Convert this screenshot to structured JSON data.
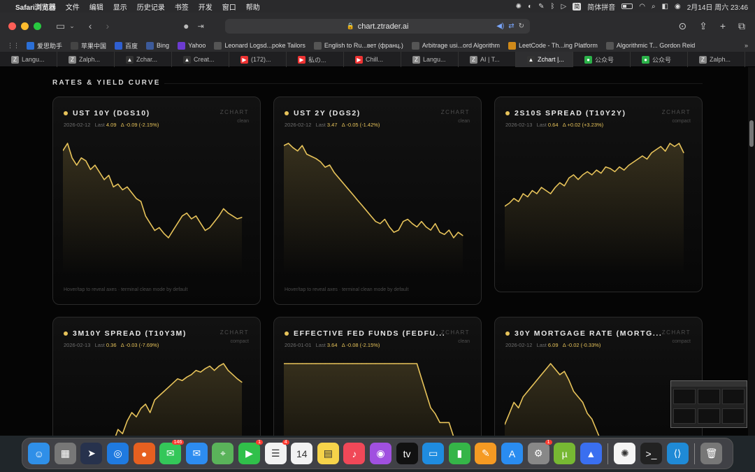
{
  "menubar": {
    "app_name": "Safari浏览器",
    "items": [
      "文件",
      "编辑",
      "显示",
      "历史记录",
      "书签",
      "开发",
      "窗口",
      "帮助"
    ],
    "ime_badge": "简",
    "ime_label": "简体拼音",
    "datetime": "2月14日 周六  23:46"
  },
  "toolbar": {
    "url": "chart.ztrader.ai"
  },
  "bookmarks": [
    {
      "label": "爱思助手",
      "icon": "aisi-icon",
      "color": "#2b6fd6"
    },
    {
      "label": "苹果中国",
      "icon": "apple-icon",
      "color": "#444"
    },
    {
      "label": "百度",
      "icon": "baidu-icon",
      "color": "#2f5fd0"
    },
    {
      "label": "Bing",
      "icon": "bing-icon",
      "color": "#3c5a9a"
    },
    {
      "label": "Yahoo",
      "icon": "yahoo-icon",
      "color": "#6c3bd1"
    },
    {
      "label": "Leonard Logsd...poke Tailors",
      "icon": "tailor-icon",
      "color": "#555"
    },
    {
      "label": "English to Ru...вет (франц.)",
      "icon": "globe-icon",
      "color": "#555"
    },
    {
      "label": "Arbitrage usi...ord Algorithm",
      "icon": "doc-icon",
      "color": "#555"
    },
    {
      "label": "LeetCode - Th...ing Platform",
      "icon": "leetcode-icon",
      "color": "#d08a1a"
    },
    {
      "label": "Algorithmic T... Gordon Reid",
      "icon": "doc-icon",
      "color": "#555"
    }
  ],
  "tabs": [
    {
      "label": "Langu...",
      "icon": "Z",
      "color": "#888"
    },
    {
      "label": "Zalph...",
      "icon": "Z",
      "color": "#888"
    },
    {
      "label": "Zchar...",
      "icon": "▲",
      "color": "#333"
    },
    {
      "label": "Creat...",
      "icon": "▲",
      "color": "#333"
    },
    {
      "label": "(172)...",
      "icon": "▶",
      "color": "#e33"
    },
    {
      "label": "私の...",
      "icon": "▶",
      "color": "#e33"
    },
    {
      "label": "Chill...",
      "icon": "▶",
      "color": "#e33"
    },
    {
      "label": "Langu...",
      "icon": "Z",
      "color": "#888"
    },
    {
      "label": "AI | T...",
      "icon": "Z",
      "color": "#888"
    },
    {
      "label": "Zchart |...",
      "icon": "▲",
      "color": "#333",
      "active": true
    },
    {
      "label": "公众号",
      "icon": "●",
      "color": "#2cb24a"
    },
    {
      "label": "公众号",
      "icon": "●",
      "color": "#2cb24a"
    },
    {
      "label": "Zalph...",
      "icon": "Z",
      "color": "#888"
    }
  ],
  "page": {
    "section_title": "RATES & YIELD CURVE",
    "accent": "#e7c35a",
    "cards": [
      {
        "title": "UST 10Y (DGS10)",
        "brand": "ZCHART",
        "mode": "clean",
        "date": "2026-02-12",
        "last_label": "Last",
        "last": "4.09",
        "delta": "Δ -0.09 (-2.15%)",
        "hint": "Hover/tap to reveal axes · terminal clean mode by default"
      },
      {
        "title": "UST 2Y (DGS2)",
        "brand": "ZCHART",
        "mode": "clean",
        "date": "2026-02-12",
        "last_label": "Last",
        "last": "3.47",
        "delta": "Δ -0.05 (-1.42%)",
        "hint": "Hover/tap to reveal axes · terminal clean mode by default"
      },
      {
        "title": "2S10S SPREAD (T10Y2Y)",
        "brand": "ZCHART",
        "mode": "compact",
        "date": "2026-02-13",
        "last_label": "Last",
        "last": "0.64",
        "delta": "Δ +0.02 (+3.23%)",
        "hint": ""
      },
      {
        "title": "3M10Y SPREAD (T10Y3M)",
        "brand": "ZCHART",
        "mode": "compact",
        "date": "2026-02-13",
        "last_label": "Last",
        "last": "0.36",
        "delta": "Δ -0.03 (-7.69%)",
        "hint": ""
      },
      {
        "title": "EFFECTIVE FED FUNDS (FEDFU...",
        "brand": "ZCHART",
        "mode": "clean",
        "date": "2026-01-01",
        "last_label": "Last",
        "last": "3.64",
        "delta": "Δ -0.08 (-2.15%)",
        "hint": ""
      },
      {
        "title": "30Y MORTGAGE RATE (MORTG...",
        "brand": "ZCHART",
        "mode": "compact",
        "date": "2026-02-12",
        "last_label": "Last",
        "last": "6.09",
        "delta": "Δ -0.02 (-0.33%)",
        "hint": ""
      }
    ]
  },
  "chart_data": [
    {
      "type": "area",
      "series": [
        {
          "values": [
            4.55,
            4.6,
            4.5,
            4.45,
            4.5,
            4.48,
            4.42,
            4.45,
            4.4,
            4.35,
            4.38,
            4.3,
            4.32,
            4.28,
            4.3,
            4.26,
            4.22,
            4.2,
            4.1,
            4.05,
            4.0,
            4.02,
            3.98,
            3.95,
            4.0,
            4.05,
            4.1,
            4.12,
            4.08,
            4.1,
            4.05,
            4.0,
            4.02,
            4.06,
            4.1,
            4.15,
            4.12,
            4.1,
            4.08,
            4.09
          ]
        }
      ]
    },
    {
      "type": "area",
      "series": [
        {
          "values": [
            4.3,
            4.32,
            4.28,
            4.25,
            4.3,
            4.22,
            4.2,
            4.18,
            4.15,
            4.1,
            4.12,
            4.05,
            4.0,
            3.95,
            3.9,
            3.85,
            3.8,
            3.75,
            3.7,
            3.65,
            3.6,
            3.58,
            3.62,
            3.55,
            3.5,
            3.52,
            3.6,
            3.62,
            3.58,
            3.55,
            3.6,
            3.55,
            3.52,
            3.58,
            3.5,
            3.48,
            3.52,
            3.45,
            3.5,
            3.47
          ]
        }
      ]
    },
    {
      "type": "area",
      "series": [
        {
          "values": [
            0.3,
            0.32,
            0.35,
            0.33,
            0.38,
            0.36,
            0.4,
            0.38,
            0.42,
            0.4,
            0.38,
            0.42,
            0.45,
            0.43,
            0.48,
            0.5,
            0.47,
            0.5,
            0.52,
            0.5,
            0.53,
            0.51,
            0.55,
            0.54,
            0.52,
            0.55,
            0.53,
            0.56,
            0.58,
            0.6,
            0.62,
            0.6,
            0.64,
            0.66,
            0.68,
            0.65,
            0.7,
            0.68,
            0.7,
            0.64
          ]
        }
      ]
    },
    {
      "type": "area",
      "series": [
        {
          "values": [
            -0.6,
            -0.55,
            -0.58,
            -0.5,
            -0.52,
            -0.48,
            -0.5,
            -0.45,
            -0.4,
            -0.42,
            -0.3,
            -0.35,
            -0.2,
            -0.25,
            -0.1,
            0.0,
            -0.05,
            0.05,
            0.1,
            0.0,
            0.15,
            0.2,
            0.25,
            0.3,
            0.35,
            0.4,
            0.38,
            0.42,
            0.45,
            0.5,
            0.48,
            0.52,
            0.55,
            0.5,
            0.55,
            0.58,
            0.5,
            0.45,
            0.4,
            0.36
          ]
        }
      ]
    },
    {
      "type": "area",
      "series": [
        {
          "values": [
            5.33,
            5.33,
            5.33,
            5.33,
            5.33,
            5.33,
            5.33,
            5.33,
            5.33,
            5.33,
            5.33,
            5.33,
            5.33,
            5.33,
            5.33,
            5.33,
            5.33,
            5.33,
            5.33,
            5.33,
            5.33,
            5.33,
            5.33,
            5.33,
            5.33,
            5.33,
            5.33,
            5.33,
            5.33,
            5.33,
            5.08,
            4.83,
            4.58,
            4.48,
            4.33,
            4.33,
            4.33,
            4.09,
            3.89,
            3.64
          ]
        }
      ]
    },
    {
      "type": "area",
      "series": [
        {
          "values": [
            6.4,
            6.5,
            6.6,
            6.55,
            6.65,
            6.7,
            6.75,
            6.8,
            6.85,
            6.9,
            6.95,
            6.9,
            6.85,
            6.88,
            6.8,
            6.7,
            6.65,
            6.6,
            6.5,
            6.45,
            6.35,
            6.25,
            6.2,
            6.15,
            6.1,
            6.05,
            6.1,
            6.15,
            6.12,
            6.08,
            6.1,
            6.05,
            6.12,
            6.1,
            6.08,
            6.11,
            6.1,
            6.12,
            6.1,
            6.09
          ]
        }
      ]
    }
  ],
  "dock": [
    {
      "name": "finder",
      "color": "#2f8fe8",
      "glyph": "☺"
    },
    {
      "name": "launchpad",
      "color": "#777",
      "glyph": "▦"
    },
    {
      "name": "telegram",
      "color": "#27324d",
      "glyph": "➤"
    },
    {
      "name": "safari",
      "color": "#1f7ae0",
      "glyph": "◎"
    },
    {
      "name": "firefox",
      "color": "#e66020",
      "glyph": "●"
    },
    {
      "name": "messages",
      "color": "#34c759",
      "glyph": "✉",
      "badge": "146"
    },
    {
      "name": "mail",
      "color": "#2d8cf0",
      "glyph": "✉"
    },
    {
      "name": "maps",
      "color": "#5ab35a",
      "glyph": "⌖"
    },
    {
      "name": "facetime",
      "color": "#30c04a",
      "glyph": "▶",
      "badge": "1"
    },
    {
      "name": "reminders",
      "color": "#f2f2f2",
      "glyph": "☰",
      "badge": "4"
    },
    {
      "name": "calendar",
      "color": "#f2f2f2",
      "glyph": "14"
    },
    {
      "name": "notes",
      "color": "#f6d34a",
      "glyph": "▤"
    },
    {
      "name": "music",
      "color": "#f04858",
      "glyph": "♪"
    },
    {
      "name": "podcasts",
      "color": "#a050e0",
      "glyph": "◉"
    },
    {
      "name": "tv",
      "color": "#111",
      "glyph": "tv"
    },
    {
      "name": "keynote",
      "color": "#1f8ce0",
      "glyph": "▭"
    },
    {
      "name": "numbers",
      "color": "#35b548",
      "glyph": "▮"
    },
    {
      "name": "pages",
      "color": "#f59a23",
      "glyph": "✎"
    },
    {
      "name": "app-store",
      "color": "#2a8cf0",
      "glyph": "A"
    },
    {
      "name": "system-settings",
      "color": "#888",
      "glyph": "⚙",
      "badge": "1"
    },
    {
      "name": "utorrent",
      "color": "#77b833",
      "glyph": "µ"
    },
    {
      "name": "nordvpn",
      "color": "#3a6ff0",
      "glyph": "▲"
    },
    {
      "sep": true
    },
    {
      "name": "chatgpt",
      "color": "#f5f5f5",
      "glyph": "✺"
    },
    {
      "name": "terminal",
      "color": "#222",
      "glyph": ">_"
    },
    {
      "name": "vscode",
      "color": "#1f8ad6",
      "glyph": "⟨⟩"
    },
    {
      "sep": true
    },
    {
      "name": "trash",
      "color": "#777",
      "glyph": "🗑"
    }
  ]
}
